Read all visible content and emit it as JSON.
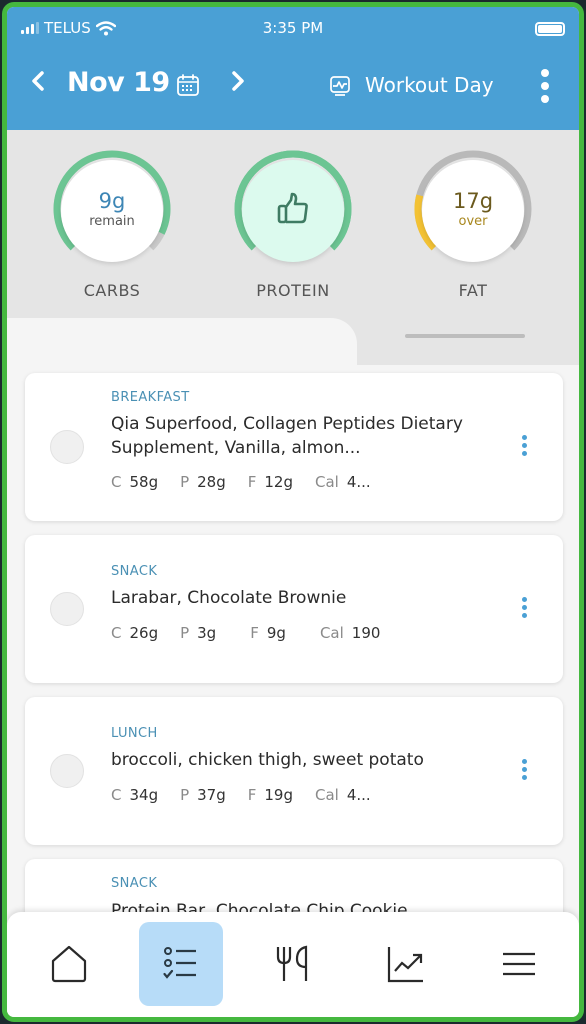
{
  "status_bar": {
    "carrier": "TELUS",
    "time": "3:35 PM"
  },
  "header": {
    "prev_icon": "chevron-left-icon",
    "date": "Nov 19",
    "calendar_icon": "calendar-icon",
    "next_icon": "chevron-right-icon",
    "day_type_icon": "activity-chart-icon",
    "day_type": "Workout Day",
    "more_icon": "more-vertical-icon"
  },
  "gauges": [
    {
      "name": "CARBS",
      "value": "9g",
      "sub": "remain",
      "progress": 0.93,
      "color": "#6cc593",
      "track": "#c9c9c9",
      "value_color": "#3d86b5",
      "sub_color": "#555555",
      "fill_bg": "#ffffff"
    },
    {
      "name": "PROTEIN",
      "icon": "thumbs-up-icon",
      "progress": 1.0,
      "color": "#6cc593",
      "track": "#6cc593",
      "fill_bg": "#dcfaee"
    },
    {
      "name": "FAT",
      "value": "17g",
      "sub": "over",
      "progress": 0.22,
      "color": "#f3c234",
      "track": "#b9b9b9",
      "value_color": "#6b5a1e",
      "sub_color": "#a8871e",
      "fill_bg": "#ffffff"
    }
  ],
  "meals": [
    {
      "type": "BREAKFAST",
      "name": "Qia Superfood, Collagen Peptides Dietary Supplement, Vanilla, almon...",
      "macros": [
        {
          "k": "C",
          "v": "58g"
        },
        {
          "k": "P",
          "v": "28g"
        },
        {
          "k": "F",
          "v": "12g"
        },
        {
          "k": "Cal",
          "v": "4..."
        }
      ]
    },
    {
      "type": "SNACK",
      "name": "Larabar, Chocolate Brownie",
      "macros": [
        {
          "k": "C",
          "v": "26g"
        },
        {
          "k": "P",
          "v": "3g"
        },
        {
          "k": "F",
          "v": "9g"
        },
        {
          "k": "Cal",
          "v": "190"
        }
      ]
    },
    {
      "type": "LUNCH",
      "name": "broccoli, chicken thigh, sweet potato",
      "macros": [
        {
          "k": "C",
          "v": "34g"
        },
        {
          "k": "P",
          "v": "37g"
        },
        {
          "k": "F",
          "v": "19g"
        },
        {
          "k": "Cal",
          "v": "4..."
        }
      ]
    },
    {
      "type": "SNACK",
      "name": "Protein Bar, Chocolate Chip Cookie"
    }
  ],
  "bottom_nav": [
    {
      "id": "home",
      "icon": "home-icon",
      "active": false
    },
    {
      "id": "log",
      "icon": "checklist-icon",
      "active": true
    },
    {
      "id": "food",
      "icon": "fork-knife-icon",
      "active": false
    },
    {
      "id": "progress",
      "icon": "trend-chart-icon",
      "active": false
    },
    {
      "id": "menu",
      "icon": "hamburger-menu-icon",
      "active": false
    }
  ],
  "colors": {
    "header_bg": "#4aa0d5",
    "accent": "#4aa0d5",
    "nav_active_bg": "#b7dcf8",
    "frame": "#45b83f"
  }
}
